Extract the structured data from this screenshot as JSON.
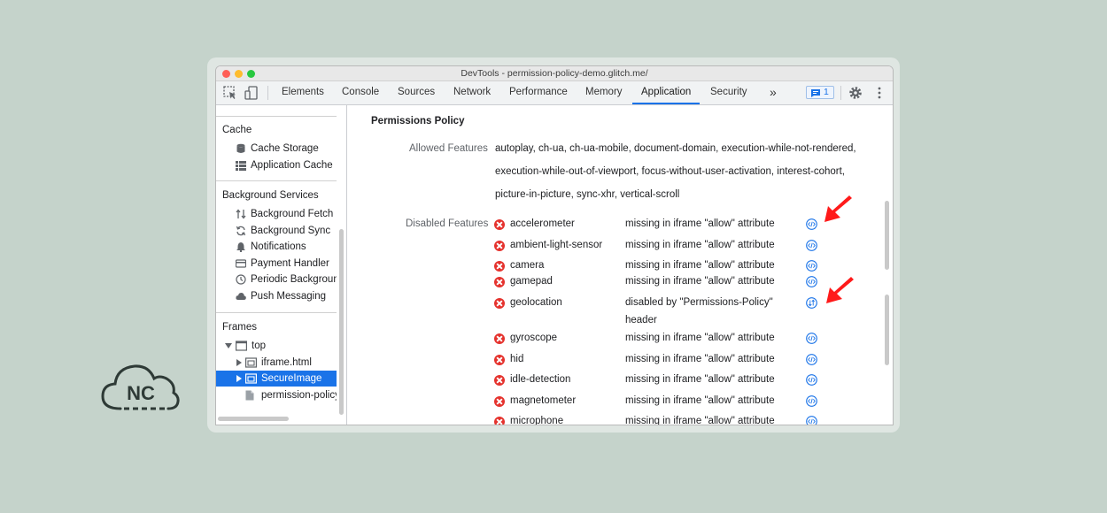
{
  "window": {
    "title": "DevTools - permission-policy-demo.glitch.me/"
  },
  "toolbar": {
    "tabs": [
      {
        "label": "Elements"
      },
      {
        "label": "Console"
      },
      {
        "label": "Sources"
      },
      {
        "label": "Network"
      },
      {
        "label": "Performance"
      },
      {
        "label": "Memory"
      },
      {
        "label": "Application",
        "active": true
      },
      {
        "label": "Security"
      }
    ],
    "more_label": "»",
    "issues_count": "1"
  },
  "sidebar": {
    "cache": {
      "heading": "Cache",
      "items": [
        {
          "label": "Cache Storage",
          "icon": "database-icon"
        },
        {
          "label": "Application Cache",
          "icon": "grid-icon"
        }
      ]
    },
    "background_services": {
      "heading": "Background Services",
      "items": [
        {
          "label": "Background Fetch",
          "icon": "arrows-updown-icon"
        },
        {
          "label": "Background Sync",
          "icon": "sync-icon"
        },
        {
          "label": "Notifications",
          "icon": "bell-icon"
        },
        {
          "label": "Payment Handler",
          "icon": "card-icon"
        },
        {
          "label": "Periodic Background Sync",
          "icon": "clock-icon"
        },
        {
          "label": "Push Messaging",
          "icon": "cloud-icon"
        }
      ]
    },
    "frames": {
      "heading": "Frames",
      "items": [
        {
          "label": "top",
          "icon": "frame-icon"
        },
        {
          "label": "iframe.html",
          "icon": "iframe-icon"
        },
        {
          "label": "SecureImage",
          "icon": "iframe-icon",
          "selected": true
        },
        {
          "label": "permission-policy.js",
          "icon": "file-icon"
        }
      ]
    }
  },
  "main": {
    "title": "Permissions Policy",
    "allowed_label": "Allowed Features",
    "allowed_lines": [
      "autoplay, ch-ua, ch-ua-mobile, document-domain, execution-while-not-rendered,",
      "execution-while-out-of-viewport, focus-without-user-activation, interest-cohort,",
      "picture-in-picture, sync-xhr, vertical-scroll"
    ],
    "disabled_label": "Disabled Features",
    "disabled_features": [
      {
        "name": "accelerometer",
        "reason": "missing in iframe \"allow\" attribute"
      },
      {
        "name": "ambient-light-sensor",
        "reason": "missing in iframe \"allow\" attribute"
      },
      {
        "name": "camera",
        "reason": "missing in iframe \"allow\" attribute"
      },
      {
        "name": "gamepad",
        "reason": "missing in iframe \"allow\" attribute"
      },
      {
        "name": "geolocation",
        "reason": "disabled by \"Permissions-Policy\"",
        "reason2": "header"
      },
      {
        "name": "gyroscope",
        "reason": "missing in iframe \"allow\" attribute"
      },
      {
        "name": "hid",
        "reason": "missing in iframe \"allow\" attribute"
      },
      {
        "name": "idle-detection",
        "reason": "missing in iframe \"allow\" attribute"
      },
      {
        "name": "magnetometer",
        "reason": "missing in iframe \"allow\" attribute"
      },
      {
        "name": "microphone",
        "reason": "missing in iframe \"allow\" attribute"
      }
    ]
  },
  "logo": {
    "text": "NC"
  },
  "colors": {
    "accent": "#1a73e8",
    "error": "#e5322d",
    "arrow": "#ff1a1a",
    "background": "#c5d3cb"
  }
}
